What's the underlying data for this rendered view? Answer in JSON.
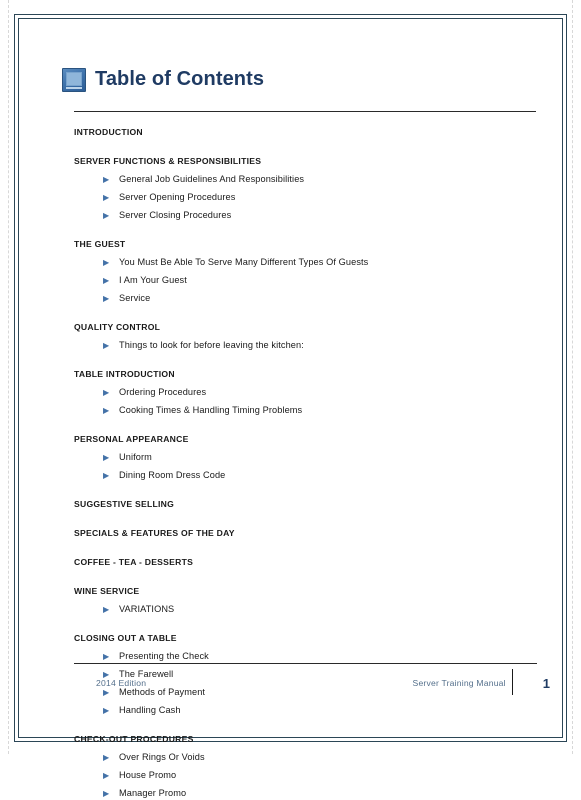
{
  "document": {
    "title": "Table of Contents",
    "title_icon": "document-square-icon"
  },
  "toc": {
    "sections": [
      {
        "heading": "INTRODUCTION",
        "items": []
      },
      {
        "heading": "SERVER FUNCTIONS & RESPONSIBILITIES",
        "items": [
          "General Job Guidelines And Responsibilities",
          "Server Opening Procedures",
          "Server Closing Procedures"
        ]
      },
      {
        "heading": "THE GUEST",
        "items": [
          "You Must Be Able To Serve Many Different Types Of Guests",
          "I Am Your Guest",
          "Service"
        ]
      },
      {
        "heading": "QUALITY CONTROL",
        "items": [
          "Things to look for before leaving the kitchen:"
        ]
      },
      {
        "heading": "TABLE INTRODUCTION",
        "items": [
          "Ordering Procedures",
          "Cooking Times & Handling Timing Problems"
        ]
      },
      {
        "heading": "PERSONAL APPEARANCE",
        "items": [
          "Uniform",
          "Dining Room Dress Code"
        ]
      },
      {
        "heading": "SUGGESTIVE SELLING",
        "items": []
      },
      {
        "heading": "SPECIALS & FEATURES OF THE DAY",
        "items": []
      },
      {
        "heading": "COFFEE - TEA - DESSERTS",
        "items": []
      },
      {
        "heading": "WINE SERVICE",
        "items": [
          "VARIATIONS"
        ]
      },
      {
        "heading": "CLOSING OUT A TABLE",
        "items": [
          "Presenting the Check",
          "The Farewell",
          "Methods of Payment",
          "Handling Cash"
        ]
      },
      {
        "heading": "CHECK-OUT PROCEDURES",
        "items": [
          "Over Rings Or Voids",
          "House Promo",
          "Manager Promo"
        ]
      }
    ],
    "bullet_glyph": "▶"
  },
  "footer": {
    "edition": "2014 Edition",
    "manual_title": "Server Training Manual",
    "page_number": "1"
  },
  "colors": {
    "title_blue": "#1f3b63",
    "border_navy": "#2b4656",
    "bullet_blue": "#4472a8",
    "footer_text": "#55708c"
  }
}
